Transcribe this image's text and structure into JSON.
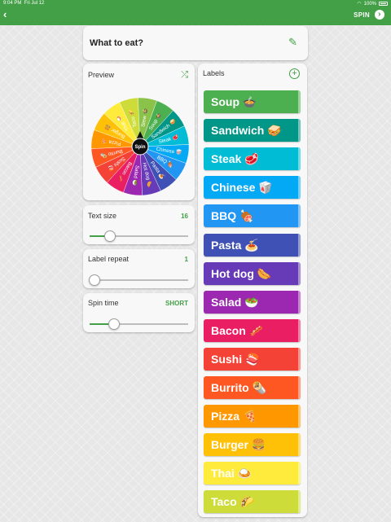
{
  "status_bar": {
    "time": "9:04 PM",
    "date": "Fri Jul 12",
    "battery": "100%"
  },
  "top_bar": {
    "back_icon": "chevron-left",
    "spin_label": "SPIN",
    "spin_icon": "arrow-right-circle"
  },
  "title_card": {
    "title": "What to eat?",
    "edit_icon": "pencil"
  },
  "preview": {
    "label": "Preview",
    "shuffle_icon": "shuffle",
    "spin_center_label": "Spin"
  },
  "text_size": {
    "label": "Text size",
    "value": "16",
    "slider_fraction": 0.21
  },
  "label_repeat": {
    "label": "Label repeat",
    "value": "1",
    "slider_fraction": 0.0
  },
  "spin_time": {
    "label": "Spin time",
    "value": "SHORT",
    "slider_fraction": 0.25
  },
  "accent_color": "#43a047",
  "labels_panel": {
    "title": "Labels",
    "add_icon": "plus-circle",
    "items": [
      {
        "text": "Soup 🍲",
        "color": "#4caf50"
      },
      {
        "text": "Sandwich 🥪",
        "color": "#009688"
      },
      {
        "text": "Steak 🥩",
        "color": "#00bcd4"
      },
      {
        "text": "Chinese 🥡",
        "color": "#03a9f4"
      },
      {
        "text": "BBQ 🍖",
        "color": "#2196f3"
      },
      {
        "text": "Pasta 🍝",
        "color": "#3f51b5"
      },
      {
        "text": "Hot dog 🌭",
        "color": "#673ab7"
      },
      {
        "text": "Salad 🥗",
        "color": "#9c27b0"
      },
      {
        "text": "Bacon 🥓",
        "color": "#e91e63"
      },
      {
        "text": "Sushi 🍣",
        "color": "#f44336"
      },
      {
        "text": "Burrito 🌯",
        "color": "#ff5722"
      },
      {
        "text": "Pizza 🍕",
        "color": "#ff9800"
      },
      {
        "text": "Burger 🍔",
        "color": "#ffc107"
      },
      {
        "text": "Thai 🍛",
        "color": "#ffeb3b"
      },
      {
        "text": "Taco 🌮",
        "color": "#cddc39"
      }
    ]
  },
  "wheel_slices": [
    {
      "text": "Soup 🍲",
      "color": "#4caf50"
    },
    {
      "text": "Sandwich 🥪",
      "color": "#009688"
    },
    {
      "text": "Steak 🥩",
      "color": "#00bcd4"
    },
    {
      "text": "Chinese 🥡",
      "color": "#03a9f4"
    },
    {
      "text": "BBQ 🍖",
      "color": "#2196f3"
    },
    {
      "text": "Pasta 🍝",
      "color": "#3f51b5"
    },
    {
      "text": "Hot dog 🌭",
      "color": "#673ab7"
    },
    {
      "text": "Salad 🥗",
      "color": "#9c27b0"
    },
    {
      "text": "Bacon 🥓",
      "color": "#e91e63"
    },
    {
      "text": "Sushi 🍣",
      "color": "#f44336"
    },
    {
      "text": "Burrito 🌯",
      "color": "#ff5722"
    },
    {
      "text": "Pizza 🍕",
      "color": "#ff9800"
    },
    {
      "text": "Burger 🍔",
      "color": "#ffc107"
    },
    {
      "text": "Thai 🍛",
      "color": "#ffeb3b"
    },
    {
      "text": "Taco 🌮",
      "color": "#cddc39"
    },
    {
      "text": "Stew 🍲",
      "color": "#8bc34a"
    }
  ]
}
